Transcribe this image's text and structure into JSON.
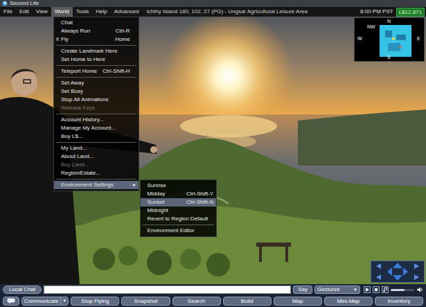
{
  "window": {
    "title": "Second Life"
  },
  "menubar": {
    "items": [
      {
        "label": "File",
        "selected": false
      },
      {
        "label": "Edit",
        "selected": false
      },
      {
        "label": "View",
        "selected": false
      },
      {
        "label": "World",
        "selected": true
      },
      {
        "label": "Tools",
        "selected": false
      },
      {
        "label": "Help",
        "selected": false
      },
      {
        "label": "Advanced",
        "selected": false
      }
    ],
    "location": "Ichthy Island 180, 102, 27 (PG) - Ungsar Agricultural Leisure Area",
    "clock": "8:00 PM PST",
    "balance": "L$12,871"
  },
  "world_menu": {
    "check_mark": "X",
    "submenu_arrow": "▸",
    "items": [
      {
        "kind": "item",
        "label": "Chat",
        "shortcut": "",
        "checked": false,
        "disabled": false,
        "selected": false,
        "submenu": false
      },
      {
        "kind": "item",
        "label": "Always Run",
        "shortcut": "Ctrl-R",
        "checked": false,
        "disabled": false,
        "selected": false,
        "submenu": false
      },
      {
        "kind": "item",
        "label": "Fly",
        "shortcut": "Home",
        "checked": true,
        "disabled": false,
        "selected": false,
        "submenu": false
      },
      {
        "kind": "separator"
      },
      {
        "kind": "item",
        "label": "Create Landmark Here",
        "shortcut": "",
        "checked": false,
        "disabled": false,
        "selected": false,
        "submenu": false
      },
      {
        "kind": "item",
        "label": "Set Home to Here",
        "shortcut": "",
        "checked": false,
        "disabled": false,
        "selected": false,
        "submenu": false
      },
      {
        "kind": "separator"
      },
      {
        "kind": "item",
        "label": "Teleport Home",
        "shortcut": "Ctrl-Shift-H",
        "checked": false,
        "disabled": false,
        "selected": false,
        "submenu": false
      },
      {
        "kind": "separator"
      },
      {
        "kind": "item",
        "label": "Set Away",
        "shortcut": "",
        "checked": false,
        "disabled": false,
        "selected": false,
        "submenu": false
      },
      {
        "kind": "item",
        "label": "Set Busy",
        "shortcut": "",
        "checked": false,
        "disabled": false,
        "selected": false,
        "submenu": false
      },
      {
        "kind": "item",
        "label": "Stop All Animations",
        "shortcut": "",
        "checked": false,
        "disabled": false,
        "selected": false,
        "submenu": false
      },
      {
        "kind": "item",
        "label": "Release Keys",
        "shortcut": "",
        "checked": false,
        "disabled": true,
        "selected": false,
        "submenu": false
      },
      {
        "kind": "separator"
      },
      {
        "kind": "item",
        "label": "Account History...",
        "shortcut": "",
        "checked": false,
        "disabled": false,
        "selected": false,
        "submenu": false
      },
      {
        "kind": "item",
        "label": "Manage My Account...",
        "shortcut": "",
        "checked": false,
        "disabled": false,
        "selected": false,
        "submenu": false
      },
      {
        "kind": "item",
        "label": "Buy L$...",
        "shortcut": "",
        "checked": false,
        "disabled": false,
        "selected": false,
        "submenu": false
      },
      {
        "kind": "separator"
      },
      {
        "kind": "item",
        "label": "My Land...",
        "shortcut": "",
        "checked": false,
        "disabled": false,
        "selected": false,
        "submenu": false
      },
      {
        "kind": "item",
        "label": "About Land...",
        "shortcut": "",
        "checked": false,
        "disabled": false,
        "selected": false,
        "submenu": false
      },
      {
        "kind": "item",
        "label": "Buy Land...",
        "shortcut": "",
        "checked": false,
        "disabled": true,
        "selected": false,
        "submenu": false
      },
      {
        "kind": "item",
        "label": "Region/Estate...",
        "shortcut": "",
        "checked": false,
        "disabled": false,
        "selected": false,
        "submenu": false
      },
      {
        "kind": "separator"
      },
      {
        "kind": "item",
        "label": "Environment Settings",
        "shortcut": "",
        "checked": false,
        "disabled": false,
        "selected": true,
        "submenu": true
      }
    ]
  },
  "environment_menu": {
    "items": [
      {
        "kind": "item",
        "label": "Sunrise",
        "shortcut": "",
        "disabled": false,
        "selected": false
      },
      {
        "kind": "item",
        "label": "Midday",
        "shortcut": "Ctrl-Shift-Y",
        "disabled": false,
        "selected": false
      },
      {
        "kind": "item",
        "label": "Sunset",
        "shortcut": "Ctrl-Shift-N",
        "disabled": false,
        "selected": true
      },
      {
        "kind": "item",
        "label": "Midnight",
        "shortcut": "",
        "disabled": false,
        "selected": false
      },
      {
        "kind": "item",
        "label": "Revert to Region Default",
        "shortcut": "",
        "disabled": false,
        "selected": false
      },
      {
        "kind": "separator"
      },
      {
        "kind": "item",
        "label": "Environment Editor",
        "shortcut": "",
        "disabled": false,
        "selected": false
      }
    ]
  },
  "minimap": {
    "directions": [
      "N",
      "NW",
      "W",
      "E",
      "S"
    ]
  },
  "chat_bar": {
    "chat_button": "Local Chat",
    "say_button": "Say",
    "gesture": "Gestures",
    "gesture_arrow": "▼",
    "volume": {
      "level": 0.6
    }
  },
  "toolbar": {
    "communicate": {
      "label": "Communicate",
      "arrow": "▼"
    },
    "buttons": [
      "Stop Flying",
      "Snapshot",
      "Search",
      "Build",
      "Map",
      "Mini-Map",
      "Inventory"
    ]
  }
}
